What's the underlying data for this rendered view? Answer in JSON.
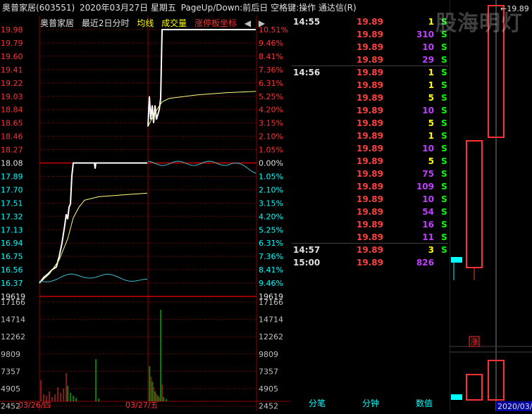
{
  "title": {
    "stock": "奥普家居(603551)",
    "date": "2020年03月27日 星期五",
    "hint": "PageUp/Down:前后日 空格键:操作 通达信(R)"
  },
  "legend": {
    "name": "奥普家居",
    "period": "最近2日分时",
    "avg": "均线",
    "volume": "成交量",
    "limit": "涨停板坐标"
  },
  "colors": {
    "up": "#ff3232",
    "down": "#00ffff",
    "price_line": "#ffffff",
    "avg_line": "#ffff80",
    "grid": "#8b0000",
    "purple": "#c040ff",
    "green": "#00ff00"
  },
  "price_axis": {
    "left": [
      "19.98",
      "19.79",
      "19.60",
      "19.41",
      "19.22",
      "19.03",
      "18.84",
      "18.65",
      "18.46",
      "18.27",
      "18.08",
      "17.89",
      "17.70",
      "17.51",
      "17.32",
      "17.13",
      "16.94",
      "16.75",
      "16.56",
      "16.37",
      "19619"
    ],
    "right": [
      "10.51%",
      "9.46%",
      "8.41%",
      "7.36%",
      "6.31%",
      "5.25%",
      "4.20%",
      "3.15%",
      "2.10%",
      "1.05%",
      "0.00%",
      "1.05%",
      "2.10%",
      "3.15%",
      "4.20%",
      "5.25%",
      "6.31%",
      "7.36%",
      "8.41%",
      "9.46%",
      "19619"
    ]
  },
  "volume_axis": {
    "left": [
      "17166",
      "14714",
      "12262",
      "9809",
      "7357",
      "4905",
      "2452"
    ],
    "right": [
      "17166",
      "14714",
      "12262",
      "9809",
      "7357",
      "4905",
      "2452"
    ]
  },
  "date_labels": [
    "03/26/四",
    "03/27/五"
  ],
  "ticks": [
    {
      "time": "14:55",
      "price": "19.89",
      "vol": "1",
      "dir": "S",
      "vcolor": "#ffff00"
    },
    {
      "time": "",
      "price": "19.89",
      "vol": "310",
      "dir": "S",
      "vcolor": "#c040ff"
    },
    {
      "time": "",
      "price": "19.89",
      "vol": "10",
      "dir": "S",
      "vcolor": "#c040ff"
    },
    {
      "time": "",
      "price": "19.89",
      "vol": "29",
      "dir": "S",
      "vcolor": "#c040ff"
    },
    {
      "time": "14:56",
      "price": "19.89",
      "vol": "1",
      "dir": "S",
      "vcolor": "#ffff00"
    },
    {
      "time": "",
      "price": "19.89",
      "vol": "1",
      "dir": "S",
      "vcolor": "#ffff00"
    },
    {
      "time": "",
      "price": "19.89",
      "vol": "5",
      "dir": "S",
      "vcolor": "#ffff00"
    },
    {
      "time": "",
      "price": "19.89",
      "vol": "10",
      "dir": "S",
      "vcolor": "#c040ff"
    },
    {
      "time": "",
      "price": "19.89",
      "vol": "5",
      "dir": "S",
      "vcolor": "#ffff00"
    },
    {
      "time": "",
      "price": "19.89",
      "vol": "1",
      "dir": "S",
      "vcolor": "#ffff00"
    },
    {
      "time": "",
      "price": "19.89",
      "vol": "10",
      "dir": "S",
      "vcolor": "#c040ff"
    },
    {
      "time": "",
      "price": "19.89",
      "vol": "5",
      "dir": "S",
      "vcolor": "#ffff00"
    },
    {
      "time": "",
      "price": "19.89",
      "vol": "75",
      "dir": "S",
      "vcolor": "#c040ff"
    },
    {
      "time": "",
      "price": "19.89",
      "vol": "109",
      "dir": "S",
      "vcolor": "#c040ff"
    },
    {
      "time": "",
      "price": "19.89",
      "vol": "10",
      "dir": "S",
      "vcolor": "#c040ff"
    },
    {
      "time": "",
      "price": "19.89",
      "vol": "54",
      "dir": "S",
      "vcolor": "#c040ff"
    },
    {
      "time": "",
      "price": "19.89",
      "vol": "16",
      "dir": "S",
      "vcolor": "#c040ff"
    },
    {
      "time": "",
      "price": "19.89",
      "vol": "11",
      "dir": "S",
      "vcolor": "#c040ff"
    },
    {
      "time": "14:57",
      "price": "19.89",
      "vol": "3",
      "dir": "S",
      "vcolor": "#ffff00"
    },
    {
      "time": "15:00",
      "price": "19.89",
      "vol": "826",
      "dir": "",
      "vcolor": "#c040ff"
    }
  ],
  "tabs": [
    "分笔",
    "分钟",
    "数值"
  ],
  "kline": {
    "high_label": "19.89",
    "zhang_label": "涨",
    "date_label": "2020/03/"
  },
  "watermark": "股海明灯"
}
